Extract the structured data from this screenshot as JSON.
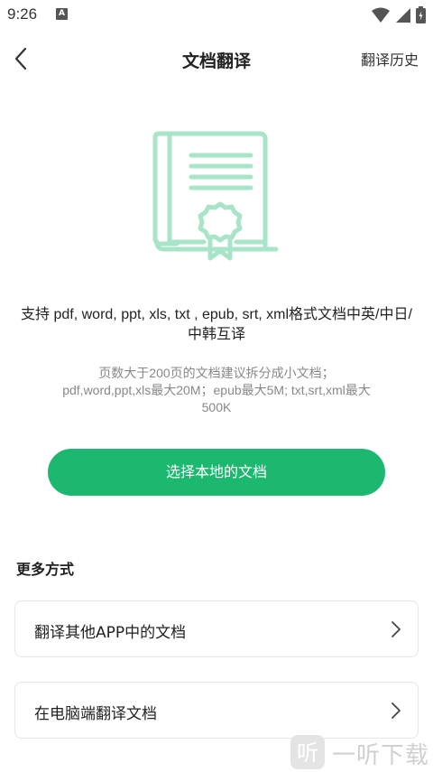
{
  "status": {
    "time": "9:26",
    "notification_letter": "A"
  },
  "nav": {
    "title": "文档翻译",
    "history_label": "翻译历史"
  },
  "info": {
    "support_text": "支持 pdf, word, ppt, xls, txt , epub, srt, xml格式文档中英/中日/中韩互译",
    "limits_line1": "页数大于200页的文档建议拆分成小文档；",
    "limits_line2": "pdf,word,ppt,xls最大20M；epub最大5M; txt,srt,xml最大",
    "limits_line3": "500K"
  },
  "select_button": {
    "label": "选择本地的文档"
  },
  "more": {
    "title": "更多方式",
    "options": [
      {
        "label": "翻译其他APP中的文档"
      },
      {
        "label": "在电脑端翻译文档"
      }
    ]
  },
  "watermark": {
    "text": "一听下载"
  },
  "colors": {
    "accent": "#1db86f",
    "illustration": "#a8e4c7"
  },
  "icons": [
    "back-arrow-icon",
    "wifi-icon",
    "signal-icon",
    "battery-icon",
    "document-certificate-icon",
    "chevron-right-icon"
  ]
}
